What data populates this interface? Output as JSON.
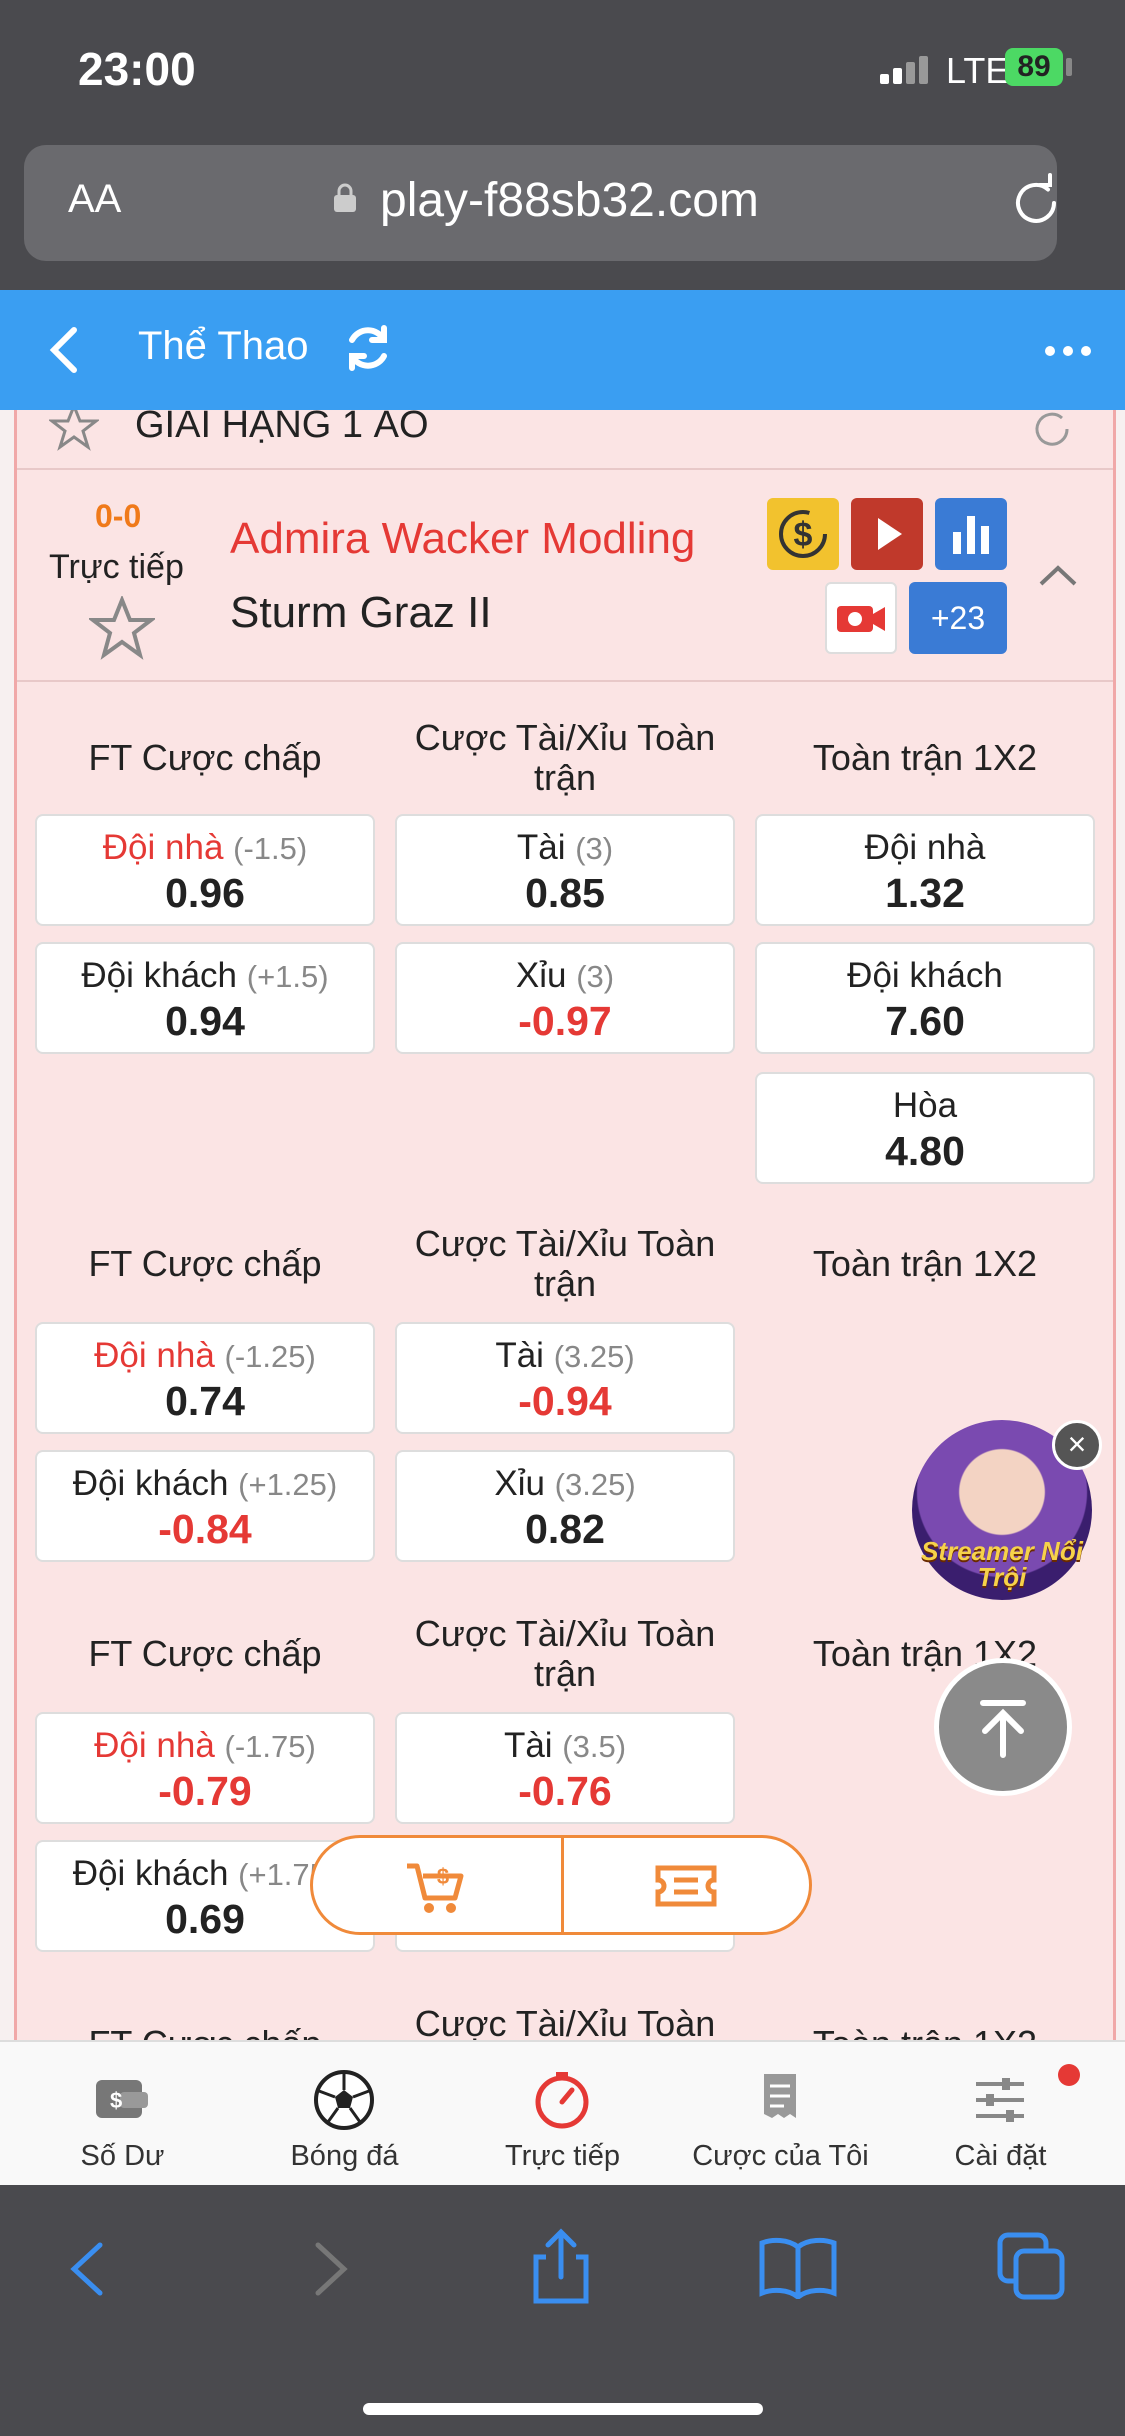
{
  "status_bar": {
    "time": "23:00",
    "network": "LTE",
    "battery": "89"
  },
  "browser": {
    "text_size_label": "AA",
    "url": "play-f88sb32.com"
  },
  "header": {
    "title": "Thể Thao"
  },
  "league": {
    "name": "GIẢI HẠNG 1 ÁO"
  },
  "match": {
    "score": "0-0",
    "status": "Trực tiếp",
    "home_team": "Admira Wacker Modling",
    "away_team": "Sturm Graz II",
    "more_markets": "+23"
  },
  "markets": [
    {
      "col1_title": "FT Cược chấp",
      "col2_title": "Cược Tài/Xỉu Toàn trận",
      "col3_title": "Toàn trận 1X2",
      "col1": [
        {
          "name": "Đội nhà",
          "hdp": "(-1.5)",
          "value": "0.96"
        },
        {
          "name": "Đội khách",
          "hdp": "(+1.5)",
          "value": "0.94"
        }
      ],
      "col2": [
        {
          "name": "Tài",
          "hdp": "(3)",
          "value": "0.85"
        },
        {
          "name": "Xỉu",
          "hdp": "(3)",
          "value": "-0.97"
        }
      ],
      "col3": [
        {
          "name": "Đội nhà",
          "value": "1.32"
        },
        {
          "name": "Đội khách",
          "value": "7.60"
        },
        {
          "name": "Hòa",
          "value": "4.80"
        }
      ]
    },
    {
      "col1_title": "FT Cược chấp",
      "col2_title": "Cược Tài/Xỉu Toàn trận",
      "col3_title": "Toàn trận 1X2",
      "col1": [
        {
          "name": "Đội nhà",
          "hdp": "(-1.25)",
          "value": "0.74"
        },
        {
          "name": "Đội khách",
          "hdp": "(+1.25)",
          "value": "-0.84"
        }
      ],
      "col2": [
        {
          "name": "Tài",
          "hdp": "(3.25)",
          "value": "-0.94"
        },
        {
          "name": "Xỉu",
          "hdp": "(3.25)",
          "value": "0.82"
        }
      ]
    },
    {
      "col1_title": "FT Cược chấp",
      "col2_title": "Cược Tài/Xỉu Toàn trận",
      "col3_title": "Toàn trận 1X2",
      "col1": [
        {
          "name": "Đội nhà",
          "hdp": "(-1.75)",
          "value": "-0.79"
        },
        {
          "name": "Đội khách",
          "hdp": "(+1.75)",
          "value": "0.69"
        }
      ],
      "col2": [
        {
          "name": "Tài",
          "hdp": "(3.5)",
          "value": "-0.76"
        }
      ]
    },
    {
      "col1_title": "FT Cược chấp",
      "col2_title": "Cược Tài/Xỉu Toàn",
      "col3_title": "Toàn trận 1X2"
    }
  ],
  "streamer_badge": "Streamer Nổi Trội",
  "tabs": [
    {
      "label": "Số Dư",
      "icon": "wallet-icon"
    },
    {
      "label": "Bóng đá",
      "icon": "soccer-ball-icon"
    },
    {
      "label": "Trực tiếp",
      "icon": "live-clock-icon"
    },
    {
      "label": "Cược của Tôi",
      "icon": "bet-slip-icon"
    },
    {
      "label": "Cài đặt",
      "icon": "settings-sliders-icon"
    }
  ],
  "colors": {
    "accent_blue": "#3a9ef2",
    "live_red": "#e53935",
    "score_orange": "#f07a1a",
    "card_bg": "#fbe4e4"
  }
}
